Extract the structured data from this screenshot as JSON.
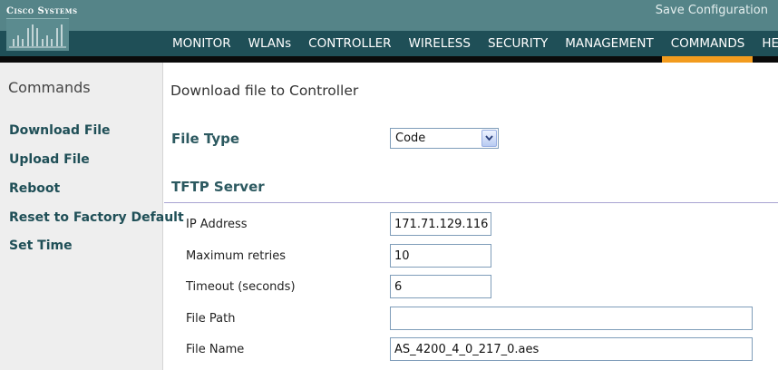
{
  "brand": {
    "name": "Cisco Systems"
  },
  "header": {
    "save_label": "Save Configuration",
    "nav": [
      "MONITOR",
      "WLANs",
      "CONTROLLER",
      "WIRELESS",
      "SECURITY",
      "MANAGEMENT",
      "COMMANDS",
      "HELP"
    ],
    "active_nav": "COMMANDS"
  },
  "sidebar": {
    "title": "Commands",
    "items": [
      "Download File",
      "Upload File",
      "Reboot",
      "Reset to Factory Default",
      "Set Time"
    ]
  },
  "main": {
    "title": "Download file to Controller",
    "file_type": {
      "label": "File Type",
      "value": "Code"
    },
    "tftp": {
      "heading": "TFTP Server",
      "fields": [
        {
          "label": "IP Address",
          "value": "171.71.129.116"
        },
        {
          "label": "Maximum retries",
          "value": "10"
        },
        {
          "label": "Timeout (seconds)",
          "value": "6"
        },
        {
          "label": "File Path",
          "value": ""
        },
        {
          "label": "File Name",
          "value": "AS_4200_4_0_217_0.aes"
        }
      ]
    }
  },
  "colors": {
    "header_top": "#558488",
    "header_nav": "#1f4f57",
    "active_tab_indicator": "#f29b1e",
    "sidebar_bg": "#eeeeee",
    "link": "#1f4f57",
    "divider": "#a9a3d2"
  },
  "icons": {
    "logo": "cisco-bridge-logo",
    "dropdown": "chevron-down-icon"
  }
}
